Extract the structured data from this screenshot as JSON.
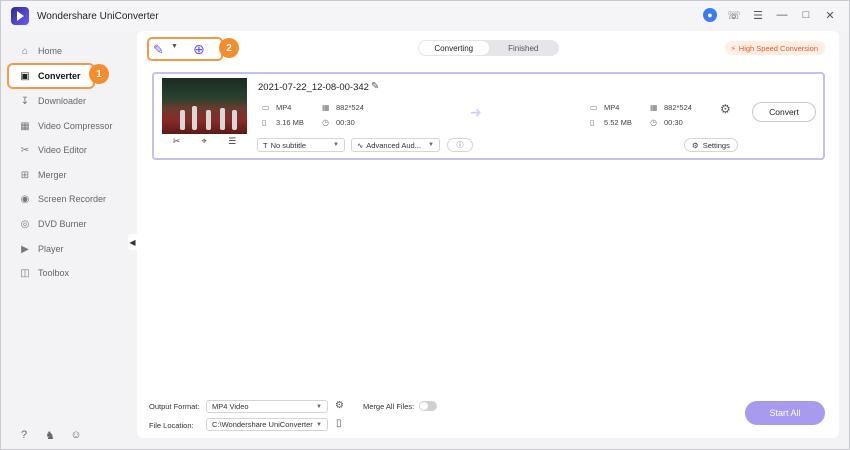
{
  "app": {
    "title": "Wondershare UniConverter"
  },
  "titlebar_icons": [
    "user-icon",
    "support-icon",
    "menu-icon",
    "minimize-icon",
    "maximize-icon",
    "close-icon"
  ],
  "sidebar": {
    "items": [
      {
        "label": "Home",
        "icon": "home-icon"
      },
      {
        "label": "Converter",
        "icon": "converter-icon",
        "active": true
      },
      {
        "label": "Downloader",
        "icon": "downloader-icon"
      },
      {
        "label": "Video Compressor",
        "icon": "compress-icon"
      },
      {
        "label": "Video Editor",
        "icon": "scissors-icon"
      },
      {
        "label": "Merger",
        "icon": "merge-icon"
      },
      {
        "label": "Screen Recorder",
        "icon": "screen-recorder-icon"
      },
      {
        "label": "DVD Burner",
        "icon": "disc-icon"
      },
      {
        "label": "Player",
        "icon": "player-icon"
      },
      {
        "label": "Toolbox",
        "icon": "toolbox-icon"
      }
    ],
    "bottom_icons": [
      "help-icon",
      "bell-icon",
      "feedback-icon"
    ]
  },
  "callouts": {
    "one": "1",
    "two": "2"
  },
  "tabs": {
    "converting": "Converting",
    "finished": "Finished"
  },
  "high_speed": {
    "label": "High Speed Conversion"
  },
  "task": {
    "filename": "2021-07-22_12-08-00-342",
    "source": {
      "format": "MP4",
      "resolution": "882*524",
      "size": "3.16 MB",
      "duration": "00:30"
    },
    "target": {
      "format": "MP4",
      "resolution": "882*524",
      "size": "5.52 MB",
      "duration": "00:30"
    },
    "subtitle": "No subtitle",
    "audio": "Advanced Aud...",
    "settings_label": "Settings",
    "convert_label": "Convert"
  },
  "bottom": {
    "output_format_label": "Output Format:",
    "output_format_value": "MP4 Video",
    "merge_label": "Merge All Files:",
    "file_location_label": "File Location:",
    "file_location_value": "C:\\Wondershare UniConverter",
    "start_all_label": "Start All"
  },
  "colors": {
    "accent": "#6a4cf0",
    "callout": "#f58d2c",
    "start_all": "#a79aef",
    "high_speed_text": "#e35a1c"
  }
}
